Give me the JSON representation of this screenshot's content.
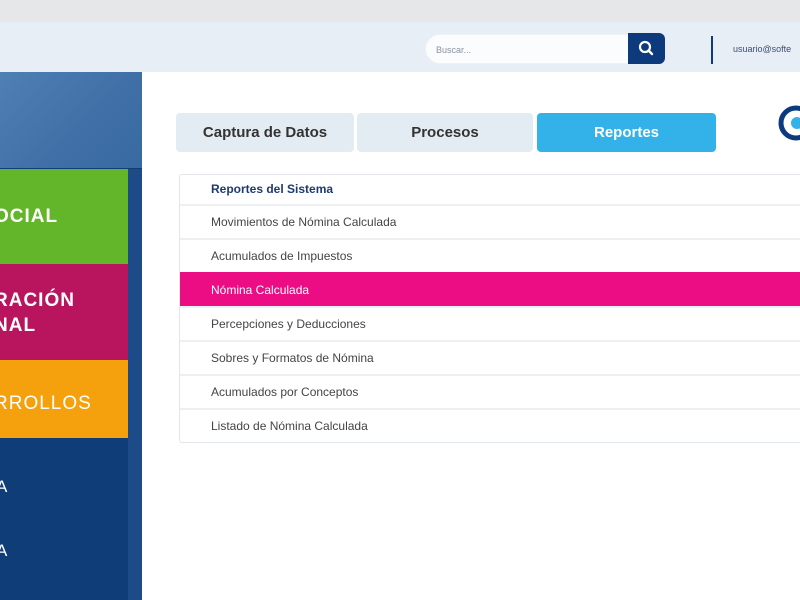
{
  "header": {
    "search_placeholder": "Buscar...",
    "user_email": "usuario@softe"
  },
  "sidebar": {
    "blocks": [
      {
        "label": "OCIAL"
      },
      {
        "label": "RACIÓN\nNAL"
      },
      {
        "label": "RROLLOS"
      }
    ],
    "items": [
      {
        "label": "A"
      },
      {
        "label": "A"
      }
    ]
  },
  "tabs": [
    {
      "label": "Captura de Datos",
      "active": false
    },
    {
      "label": "Procesos",
      "active": false
    },
    {
      "label": "Reportes",
      "active": true
    }
  ],
  "reports": {
    "title": "Reportes del Sistema",
    "items": [
      {
        "label": "Movimientos de Nómina Calculada"
      },
      {
        "label": "Acumulados de Impuestos"
      },
      {
        "label": "Nómina Calculada",
        "active": true
      },
      {
        "label": "Percepciones y Deducciones"
      },
      {
        "label": "Sobres y Formatos de Nómina"
      },
      {
        "label": "Acumulados por Conceptos"
      },
      {
        "label": "Listado de Nómina Calculada"
      }
    ]
  },
  "colors": {
    "navy": "#0c3a7c",
    "tab_active": "#33b2ea",
    "row_highlight": "#ec0c84",
    "green": "#63b52a",
    "magenta": "#b8155e",
    "orange": "#f5a10d"
  },
  "icons": [
    "search-icon",
    "brand-logo-icon"
  ]
}
